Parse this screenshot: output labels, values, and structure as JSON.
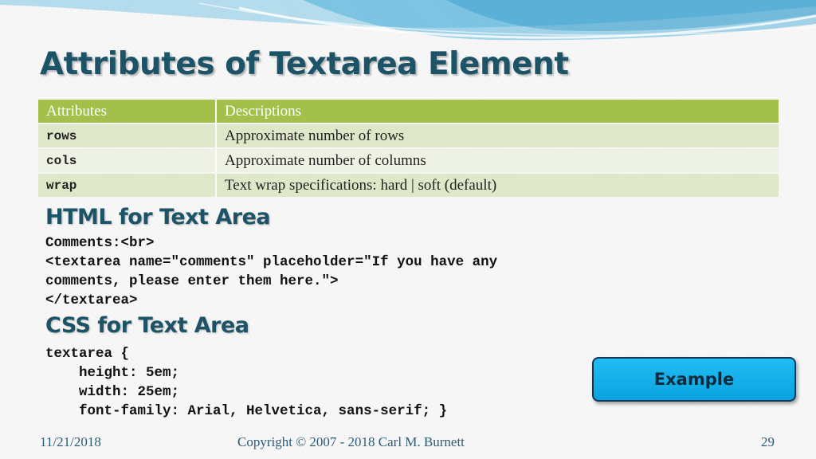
{
  "slide": {
    "title": "Attributes of Textarea Element",
    "accent_color": "#a2c04a",
    "heading_color": "#1d5366"
  },
  "table": {
    "headers": [
      "Attributes",
      "Descriptions"
    ],
    "rows": [
      {
        "attribute": "rows",
        "description": "Approximate number of rows"
      },
      {
        "attribute": "cols",
        "description": "Approximate number of columns"
      },
      {
        "attribute": "wrap",
        "description": "Text wrap specifications: hard | soft (default)"
      }
    ]
  },
  "html_section": {
    "heading": "HTML for Text Area",
    "code": [
      "Comments:<br>",
      "<textarea name=\"comments\" placeholder=\"If you have any",
      "comments, please enter them here.\">",
      "</textarea>"
    ]
  },
  "css_section": {
    "heading": "CSS for Text Area",
    "code": [
      "textarea {",
      "    height: 5em;",
      "    width: 25em;",
      "    font-family: Arial, Helvetica, sans-serif; }"
    ]
  },
  "example_button": {
    "label": "Example"
  },
  "footer": {
    "date": "11/21/2018",
    "copyright": "Copyright © 2007 - 2018 Carl M. Burnett",
    "page_number": "29"
  }
}
